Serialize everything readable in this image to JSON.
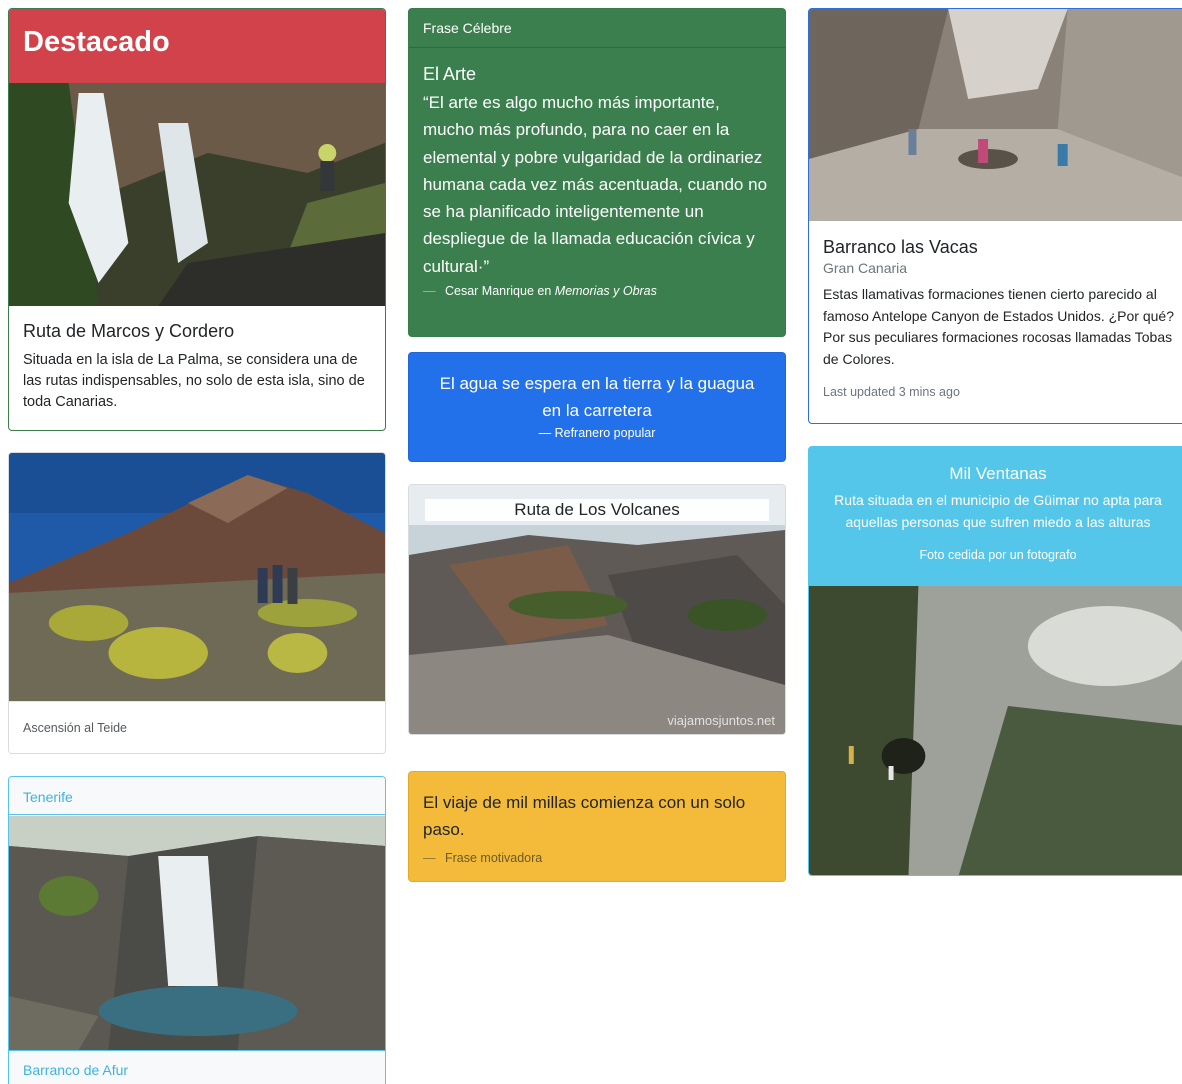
{
  "destacado": {
    "header": "Destacado",
    "title": "Ruta de Marcos y Cordero",
    "text": "Situada en la isla de La Palma, se considera una de las rutas indispensables, no solo de esta isla, sino de toda Canarias."
  },
  "teide": {
    "caption": "Ascensión al Teide"
  },
  "tenerife": {
    "header": "Tenerife",
    "footer": "Barranco de Afur"
  },
  "frase_celebre": {
    "header": "Frase Célebre",
    "title": "El Arte",
    "quote": "“El arte es algo mucho más importante, mucho más profundo, para no caer en la elemental y pobre vulgaridad de la ordinariez humana cada vez más acentuada, cuando no se ha planificado inteligentemente un despliegue de la llamada educación cívica y cultural·”",
    "author": "Cesar Manrique en",
    "source": "Memorias y Obras"
  },
  "agua": {
    "quote": "El agua se espera en la tierra y la guagua en la carretera",
    "author": "Refranero popular"
  },
  "volcanes": {
    "overlay": "Ruta de Los Volcanes",
    "watermark": "viajamosjuntos.net"
  },
  "viaje": {
    "quote": "El viaje de mil millas comienza con un solo paso.",
    "author": "Frase motivadora"
  },
  "vacas": {
    "title": "Barranco las Vacas",
    "subtitle": "Gran Canaria",
    "text": "Estas llamativas formaciones tienen cierto parecido al famoso Antelope Canyon de Estados Unidos. ¿Por qué? Por sus peculiares formaciones rocosas llamadas Tobas de Colores.",
    "updated": "Last updated 3 mins ago"
  },
  "ventanas": {
    "title": "Mil Ventanas",
    "text": "Ruta situada en el municipio de Güimar no apta para aquellas personas que sufren miedo a las alturas",
    "note": "Foto cedida por un fotografo"
  },
  "dash": "—"
}
